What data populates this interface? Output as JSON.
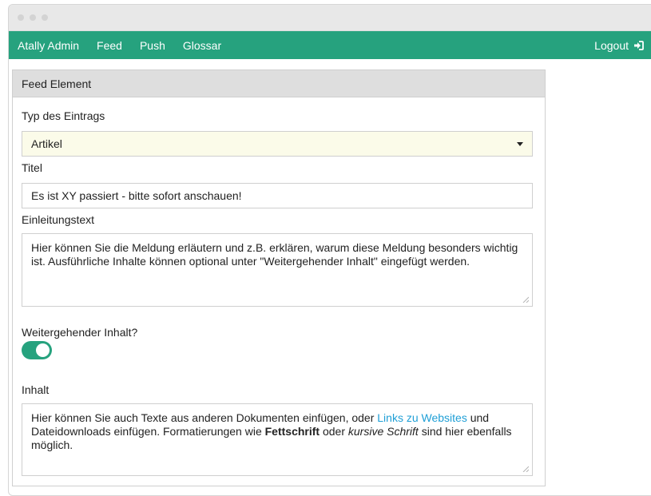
{
  "nav": {
    "items": [
      "Atally Admin",
      "Feed",
      "Push",
      "Glossar"
    ],
    "logout_label": "Logout"
  },
  "panel": {
    "heading": "Feed Element",
    "type_label": "Typ des Eintrags",
    "type_value": "Artikel",
    "title_label": "Titel",
    "title_value": "Es ist XY passiert - bitte sofort anschauen!",
    "intro_label": "Einleitungstext",
    "intro_value": "Hier können Sie die Meldung erläutern und z.B. erklären, warum diese Meldung besonders wichtig ist. Ausführliche Inhalte können optional unter \"Weitergehender Inhalt\" eingefügt werden.",
    "more_label": "Weitergehender Inhalt?",
    "more_enabled": true,
    "content_label": "Inhalt",
    "content": {
      "part1": "Hier können Sie auch Texte aus anderen Dokumenten einfügen, oder ",
      "link": "Links zu Websites",
      "part2": " und Dateidownloads einfügen. Formatierungen wie ",
      "bold": "Fettschrift",
      "part3": " oder ",
      "italic": "kursive Schrift",
      "part4": " sind hier ebenfalls möglich."
    }
  },
  "colors": {
    "accent": "#26a27e",
    "link": "#1f9fd6",
    "select_bg": "#fbfbe9"
  },
  "icons": {
    "logout": "sign-in-icon"
  }
}
